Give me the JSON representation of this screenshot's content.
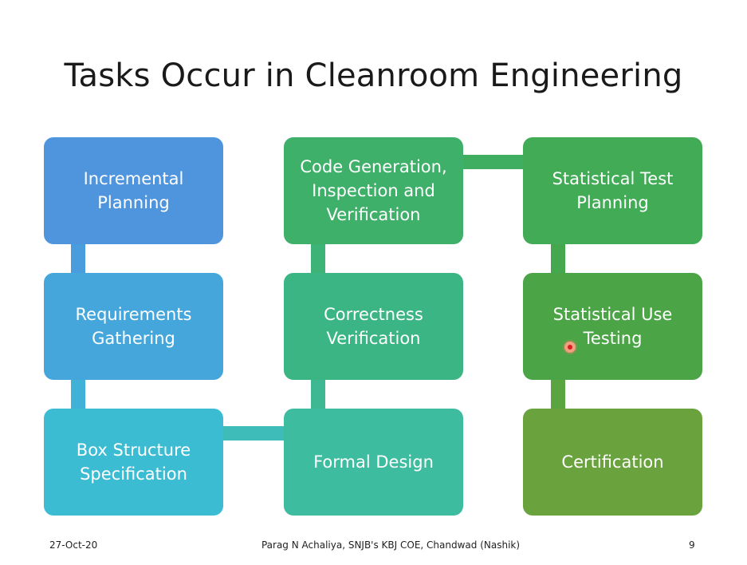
{
  "slide": {
    "title": "Tasks Occur in Cleanroom Engineering",
    "boxes": {
      "incremental_planning": "Incremental\nPlanning",
      "requirements_gathering": "Requirements\nGathering",
      "box_structure_specification": "Box Structure\nSpecification",
      "formal_design": "Formal Design",
      "correctness_verification": "Correctness\nVerification",
      "code_generation": "Code Generation,\nInspection and\nVerification",
      "statistical_test_planning": "Statistical Test\nPlanning",
      "statistical_use_testing": "Statistical Use\nTesting",
      "certification": "Certification"
    },
    "colors": {
      "incremental_planning": "#4f95de",
      "requirements_gathering": "#44a6da",
      "box_structure_specification": "#3cbcd3",
      "formal_design": "#3dbca0",
      "correctness_verification": "#3cb584",
      "code_generation": "#3fb06a",
      "statistical_test_planning": "#41ab56",
      "statistical_use_testing": "#4ba546",
      "certification": "#6aa33e"
    }
  },
  "footer": {
    "date": "27-Oct-20",
    "author": "Parag N Achaliya, SNJB's KBJ COE, Chandwad (Nashik)",
    "page_number": "9"
  }
}
